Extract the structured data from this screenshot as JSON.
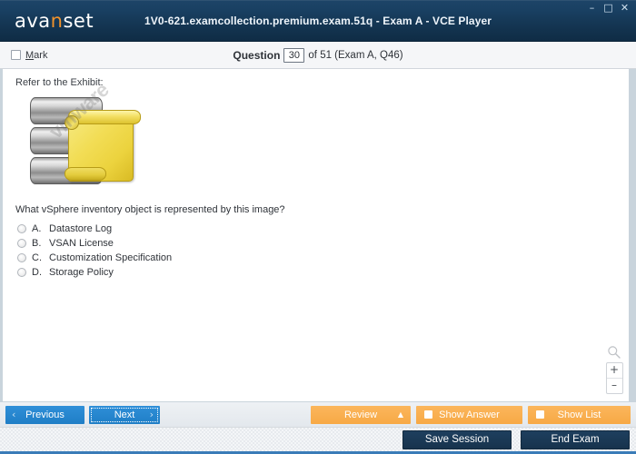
{
  "titlebar": {
    "logo_prefix": "ava",
    "logo_accent": "n",
    "logo_suffix": "set",
    "window_title": "1V0-621.examcollection.premium.exam.51q - Exam A - VCE Player",
    "minimize_icon": "–",
    "maximize_icon": "□",
    "close_icon": "✕",
    "minimize_name": "minimize",
    "maximize_name": "maximize",
    "close_name": "close"
  },
  "question_header": {
    "mark_label_pre": "M",
    "mark_label_post": "ark",
    "mark_checked": false,
    "question_word": "Question",
    "question_number": "30",
    "rest": "of 51 (Exam A, Q46)"
  },
  "content": {
    "exhibit_label": "Refer to the Exhibit:",
    "exhibit_watermark": "vmware",
    "question_text": "What vSphere inventory object is represented by this image?",
    "options": [
      {
        "letter": "A.",
        "text": "Datastore Log",
        "selected": false
      },
      {
        "letter": "B.",
        "text": "VSAN License",
        "selected": false
      },
      {
        "letter": "C.",
        "text": "Customization Specification",
        "selected": false
      },
      {
        "letter": "D.",
        "text": "Storage Policy",
        "selected": false
      }
    ],
    "zoom_in_label": "+",
    "zoom_out_label": "–"
  },
  "toolbar": {
    "previous_label": "Previous",
    "previous_chevron": "‹",
    "next_label": "Next",
    "next_chevron": "›",
    "review_label": "Review",
    "review_caret": "▲",
    "show_answer_label": "Show Answer",
    "show_list_label": "Show List"
  },
  "toolbar2": {
    "save_session_label": "Save Session",
    "end_exam_label": "End Exam"
  },
  "colors": {
    "titlebar_navy": "#194062",
    "logo_accent": "#f0922b",
    "accent_blue": "#1f7ec6",
    "accent_orange": "#f7a945",
    "navy_button": "#1e3f5e",
    "content_border": "#c9d4dc"
  }
}
